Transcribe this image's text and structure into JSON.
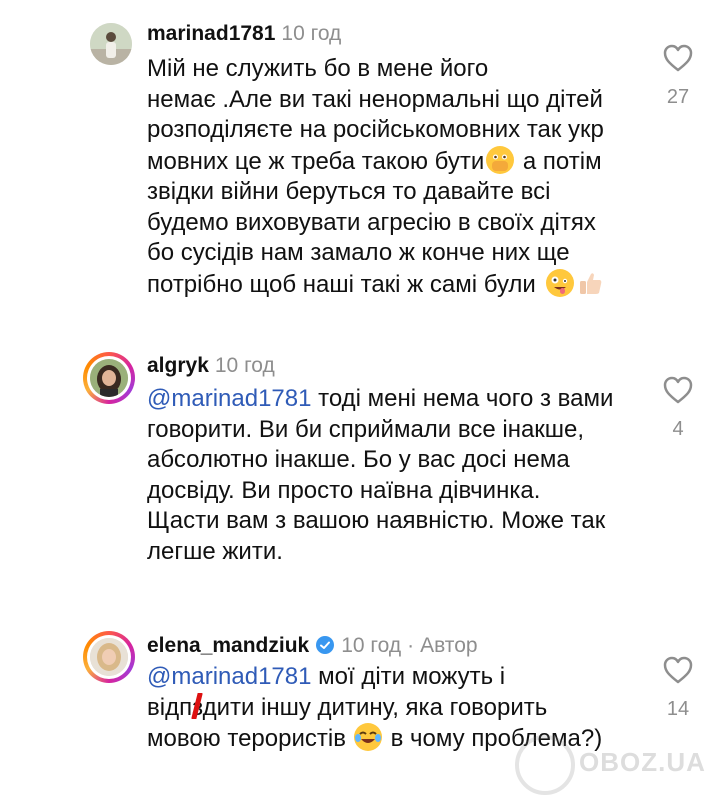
{
  "comments": [
    {
      "username": "marinad1781",
      "time": "10 год",
      "text": "Мій не служить бо в мене його\nнемає .Але ви такі ненормальні що дітей\nрозподіляєте на російськомовних так укр\nмовних це ж треба такою бути",
      "text_after_emoji": " а потім\nзвідки війни беруться то давайте всі\nбудемо виховувати агресію в своїх дітях\nбо сусідів нам замало ж конче них ще\nпотрібно щоб наші такі ж самі були",
      "likes": "27"
    },
    {
      "username": "algryk",
      "time": "10 год",
      "mention": "@marinad1781",
      "text": " тоді мені нема чого з вами\nговорити. Ви би сприймали все інакше,\nабсолютно інакше. Бо у вас досі нема\nдосвіду. Ви просто наївна дівчинка.\nЩасти вам з вашою наявністю. Може так\nлегше жити.",
      "likes": "4"
    },
    {
      "username": "elena_mandziuk",
      "time": "10 год",
      "separator": "·",
      "author_label": "Автор",
      "mention": "@marinad1781",
      "text": " мої діти можуть і\nвідп",
      "text_mid": "здити іншу дитину, яка говорить\nмовою терористів",
      "text_end": " в чому проблема?)",
      "likes": "14"
    }
  ],
  "watermark": "OBOZ.UA",
  "colors": {
    "mention": "#2f5bb7",
    "muted": "#8e8e8e",
    "verified": "#3897f0",
    "story_ring": [
      "#fd5949",
      "#d6249f",
      "#fbb03b"
    ]
  },
  "icons": [
    "heart-outline-icon",
    "verified-badge-icon",
    "hands-over-mouth-emoji",
    "zany-face-emoji",
    "thumbs-up-emoji",
    "tears-of-joy-emoji"
  ]
}
